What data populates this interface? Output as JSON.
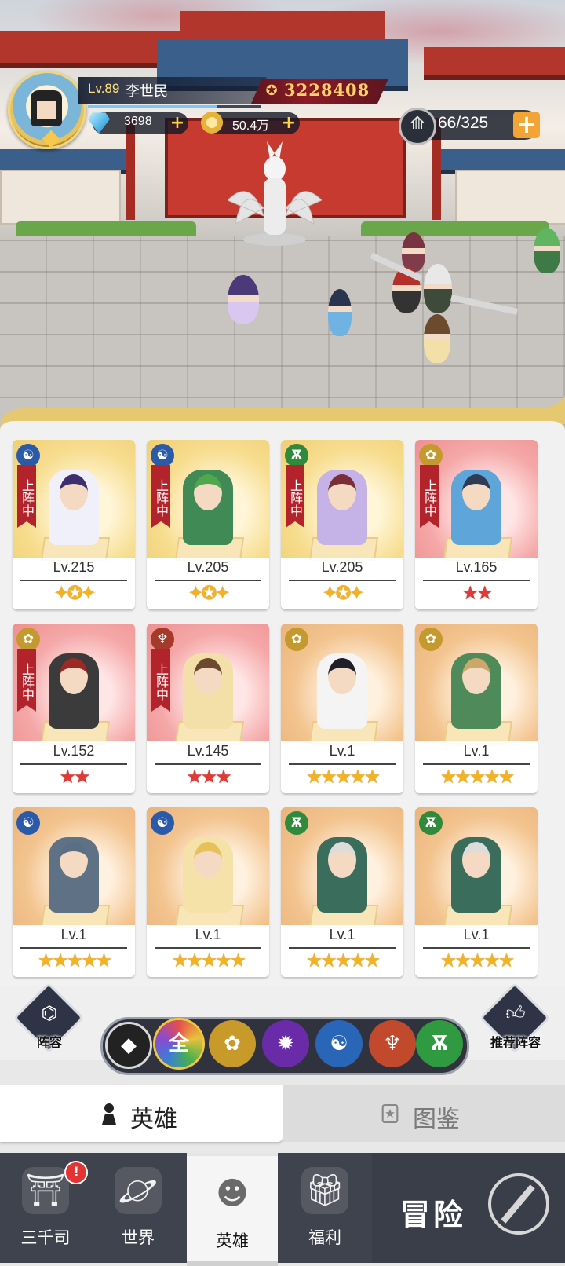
{
  "player": {
    "level": "Lv.89",
    "name": "李世民",
    "power": "3228408",
    "diamonds": "3698",
    "gold": "50.4万",
    "stamina": "66/325",
    "xp_progress": 0.75
  },
  "heroes": [
    {
      "faction": "water-icon",
      "deployed": true,
      "deploy_label": "上阵中",
      "level": "Lv.215",
      "bg": "gold",
      "stars": "✦✪✦",
      "star_style": "wing"
    },
    {
      "faction": "water-icon",
      "deployed": true,
      "deploy_label": "上阵中",
      "level": "Lv.205",
      "bg": "gold",
      "stars": "✦✪✦",
      "star_style": "wing"
    },
    {
      "faction": "nature-icon",
      "deployed": true,
      "deploy_label": "上阵中",
      "level": "Lv.205",
      "bg": "gold",
      "stars": "✦✪✦",
      "star_style": "wing"
    },
    {
      "faction": "light-icon",
      "deployed": true,
      "deploy_label": "上阵中",
      "level": "Lv.165",
      "bg": "red",
      "stars": "★★",
      "star_style": "red"
    },
    {
      "faction": "light-icon",
      "deployed": true,
      "deploy_label": "上阵中",
      "level": "Lv.152",
      "bg": "red",
      "stars": "★★",
      "star_style": "red"
    },
    {
      "faction": "spirit-icon",
      "deployed": true,
      "deploy_label": "上阵中",
      "level": "Lv.145",
      "bg": "red",
      "stars": "★★★",
      "star_style": "red"
    },
    {
      "faction": "light-icon",
      "deployed": false,
      "deploy_label": "",
      "level": "Lv.1",
      "bg": "orange",
      "stars": "★★★★★",
      "star_style": "yellow"
    },
    {
      "faction": "light-icon",
      "deployed": false,
      "deploy_label": "",
      "level": "Lv.1",
      "bg": "orange",
      "stars": "★★★★★",
      "star_style": "yellow"
    },
    {
      "faction": "water-icon",
      "deployed": false,
      "deploy_label": "",
      "level": "Lv.1",
      "bg": "orange",
      "stars": "★★★★★",
      "star_style": "yellow"
    },
    {
      "faction": "water-icon",
      "deployed": false,
      "deploy_label": "",
      "level": "Lv.1",
      "bg": "orange",
      "stars": "★★★★★",
      "star_style": "yellow"
    },
    {
      "faction": "nature-icon",
      "deployed": false,
      "deploy_label": "",
      "level": "Lv.1",
      "bg": "orange",
      "stars": "★★★★★",
      "star_style": "yellow"
    },
    {
      "faction": "nature-icon",
      "deployed": false,
      "deploy_label": "",
      "level": "Lv.1",
      "bg": "orange",
      "stars": "★★★★★",
      "star_style": "yellow"
    }
  ],
  "filters": {
    "formation_label": "阵容",
    "recommend_label": "推荐阵容",
    "all_label": "全",
    "items": [
      "diamond-filter-icon",
      "all-filter",
      "lotus-filter-icon",
      "fire-filter-icon",
      "water-filter-icon",
      "spirit-filter-icon",
      "nature-filter-icon"
    ],
    "active": "all-filter"
  },
  "tabs": {
    "heroes": "英雄",
    "codex": "图鉴"
  },
  "nav": {
    "sanqiansi": "三千司",
    "world": "世界",
    "heroes": "英雄",
    "welfare": "福利",
    "adventure": "冒险",
    "badge": "!"
  },
  "colors": {
    "deploy_ribbon": "#b3232b",
    "star_yellow": "#f5b21f",
    "star_red": "#e03a36",
    "nav_bg": "#3f434d"
  }
}
